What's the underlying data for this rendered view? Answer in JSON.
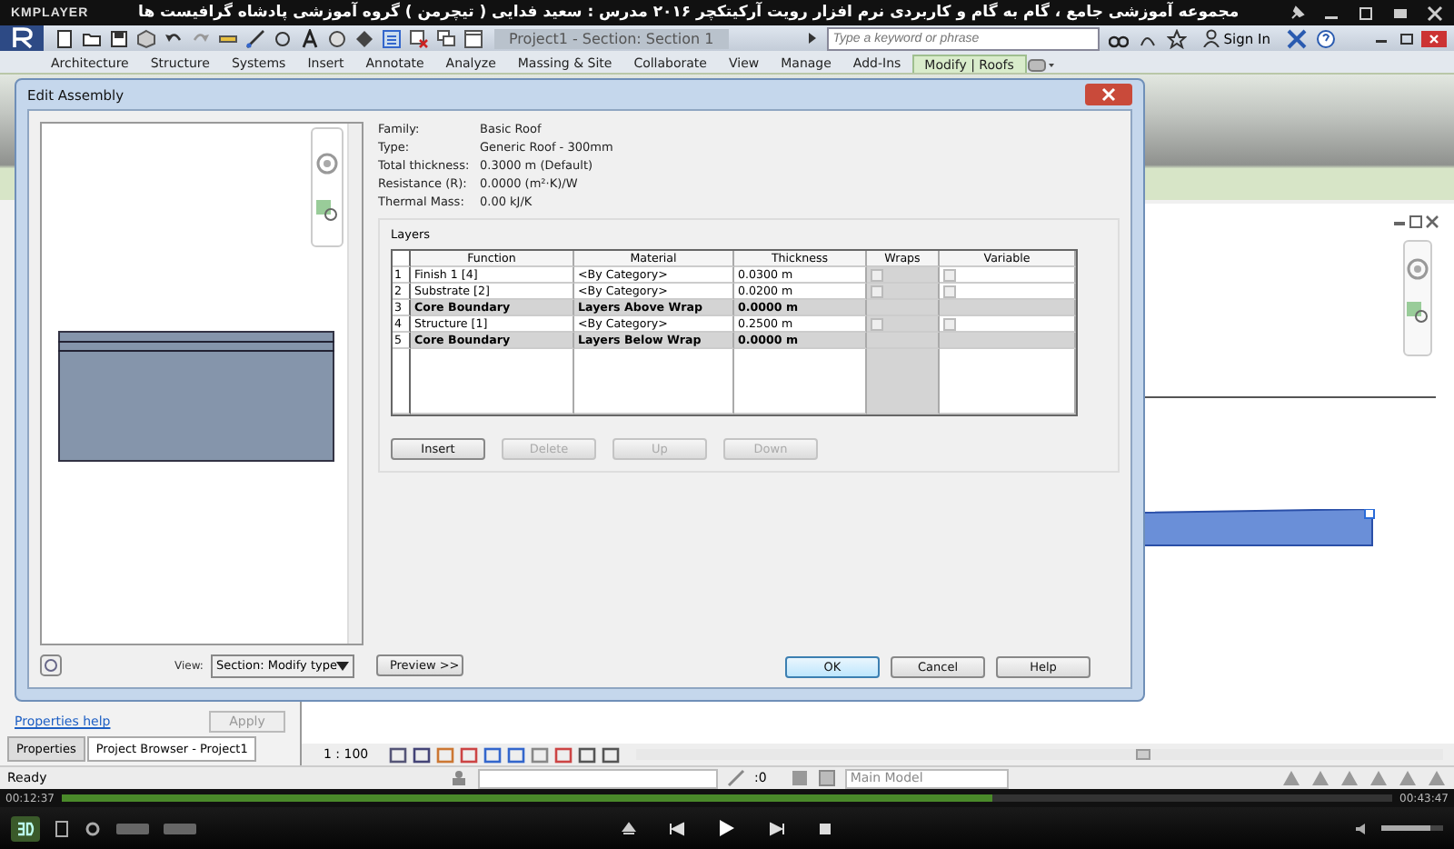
{
  "player": {
    "logo": "KMPLAYER",
    "title": "مجموعه آموزشی جامع ، گام به گام و کاربردی نرم افزار رویت آرکیتکچر ۲۰۱۶  مدرس : سعید فدایی ( تیچرمن ) گروه آموزشی پادشاه گرافیست ها",
    "elapsed": "00:12:37",
    "total": "00:43:47",
    "progress": {
      "level": 0.7
    },
    "volume": {
      "level": 0.8
    }
  },
  "app": {
    "title": "Project1 - Section: Section 1",
    "search": {
      "placeholder": "Type a keyword or phrase"
    },
    "sign_in": "Sign In",
    "tabs": [
      {
        "label": "Architecture",
        "selected": false
      },
      {
        "label": "Structure",
        "selected": false
      },
      {
        "label": "Systems",
        "selected": false
      },
      {
        "label": "Insert",
        "selected": false
      },
      {
        "label": "Annotate",
        "selected": false
      },
      {
        "label": "Analyze",
        "selected": false
      },
      {
        "label": "Massing & Site",
        "selected": false
      },
      {
        "label": "Collaborate",
        "selected": false
      },
      {
        "label": "View",
        "selected": false
      },
      {
        "label": "Manage",
        "selected": false
      },
      {
        "label": "Add-Ins",
        "selected": false
      },
      {
        "label": "Modify | Roofs",
        "selected": true
      }
    ]
  },
  "properties_panel": {
    "help_link": "Properties help",
    "apply": "Apply",
    "tabs": [
      {
        "label": "Properties",
        "selected": false
      },
      {
        "label": "Project Browser - Project1",
        "selected": true
      }
    ]
  },
  "view_bar": {
    "scale": "1 : 100"
  },
  "status_bar": {
    "text": "Ready",
    "count": ":0",
    "model": "Main Model"
  },
  "dialog": {
    "title": "Edit Assembly",
    "properties": [
      {
        "label": "Family:",
        "value": "Basic Roof"
      },
      {
        "label": "Type:",
        "value": "Generic Roof - 300mm"
      },
      {
        "label": "Total thickness:",
        "value": "0.3000 m (Default)"
      },
      {
        "label": "Resistance (R):",
        "value": "0.0000 (m²·K)/W"
      },
      {
        "label": "Thermal Mass:",
        "value": "0.00 kJ/K"
      }
    ],
    "layers_title": "Layers",
    "table": {
      "columns": [
        "Function",
        "Material",
        "Thickness",
        "Wraps",
        "Variable"
      ],
      "rows": [
        {
          "kind": "layer",
          "num": "1",
          "function": "Finish 1 [4]",
          "material": "<By Category>",
          "thickness": "0.0300 m",
          "wraps": false,
          "variable": false
        },
        {
          "kind": "layer",
          "num": "2",
          "function": "Substrate [2]",
          "material": "<By Category>",
          "thickness": "0.0200 m",
          "wraps": false,
          "variable": false
        },
        {
          "kind": "core",
          "num": "3",
          "function": "Core Boundary",
          "material": "Layers Above Wrap",
          "thickness": "0.0000 m"
        },
        {
          "kind": "layer",
          "num": "4",
          "function": "Structure [1]",
          "material": "<By Category>",
          "thickness": "0.2500 m",
          "wraps": false,
          "variable": false
        },
        {
          "kind": "core",
          "num": "5",
          "function": "Core Boundary",
          "material": "Layers Below Wrap",
          "thickness": "0.0000 m"
        }
      ]
    },
    "layer_buttons": [
      {
        "label": "Insert",
        "disabled": false
      },
      {
        "label": "Delete",
        "disabled": true
      },
      {
        "label": "Up",
        "disabled": true
      },
      {
        "label": "Down",
        "disabled": true
      }
    ],
    "view_label": "View:",
    "view_select": "Section: Modify type",
    "preview": "Preview >>",
    "buttons": [
      "OK",
      "Cancel",
      "Help"
    ]
  }
}
